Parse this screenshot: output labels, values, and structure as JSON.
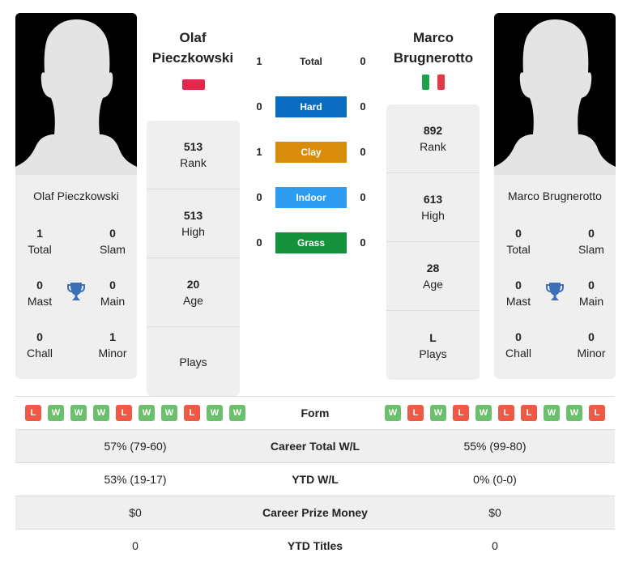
{
  "player1": {
    "name_line1": "Olaf",
    "name_line2": "Pieczkowski",
    "full_name": "Olaf Pieczkowski",
    "flag": "poland-flag",
    "titles": {
      "total": "1",
      "total_label": "Total",
      "slam": "0",
      "slam_label": "Slam",
      "mast": "0",
      "mast_label": "Mast",
      "main": "0",
      "main_label": "Main",
      "chall": "0",
      "chall_label": "Chall",
      "minor": "1",
      "minor_label": "Minor"
    },
    "stats": [
      {
        "value": "513",
        "label": "Rank"
      },
      {
        "value": "513",
        "label": "High"
      },
      {
        "value": "20",
        "label": "Age"
      },
      {
        "value": "",
        "label": "Plays"
      }
    ],
    "form": [
      "L",
      "W",
      "W",
      "W",
      "L",
      "W",
      "W",
      "L",
      "W",
      "W"
    ]
  },
  "player2": {
    "name_line1": "Marco",
    "name_line2": "Brugnerotto",
    "full_name": "Marco Brugnerotto",
    "flag": "italy-flag",
    "titles": {
      "total": "0",
      "total_label": "Total",
      "slam": "0",
      "slam_label": "Slam",
      "mast": "0",
      "mast_label": "Mast",
      "main": "0",
      "main_label": "Main",
      "chall": "0",
      "chall_label": "Chall",
      "minor": "0",
      "minor_label": "Minor"
    },
    "stats": [
      {
        "value": "892",
        "label": "Rank"
      },
      {
        "value": "613",
        "label": "High"
      },
      {
        "value": "28",
        "label": "Age"
      },
      {
        "value": "L",
        "label": "Plays"
      }
    ],
    "form": [
      "W",
      "L",
      "W",
      "L",
      "W",
      "L",
      "L",
      "W",
      "W",
      "L"
    ]
  },
  "h2h": [
    {
      "label": "Total",
      "p1": "1",
      "p2": "0",
      "color": null
    },
    {
      "label": "Hard",
      "p1": "0",
      "p2": "0",
      "color": "#0a6dc2"
    },
    {
      "label": "Clay",
      "p1": "1",
      "p2": "0",
      "color": "#d98c0a"
    },
    {
      "label": "Indoor",
      "p1": "0",
      "p2": "0",
      "color": "#2d9bf0"
    },
    {
      "label": "Grass",
      "p1": "0",
      "p2": "0",
      "color": "#14913a"
    }
  ],
  "colors": {
    "win": "#6cbf6c",
    "loss": "#ee5a45",
    "trophy": "#3d6fb8",
    "card_bg": "#efefef"
  },
  "table": {
    "form_label": "Form",
    "rows": [
      {
        "p1": "57% (79-60)",
        "label": "Career Total W/L",
        "p2": "55% (99-80)"
      },
      {
        "p1": "53% (19-17)",
        "label": "YTD W/L",
        "p2": "0% (0-0)"
      },
      {
        "p1": "$0",
        "label": "Career Prize Money",
        "p2": "$0"
      },
      {
        "p1": "0",
        "label": "YTD Titles",
        "p2": "0"
      }
    ]
  }
}
